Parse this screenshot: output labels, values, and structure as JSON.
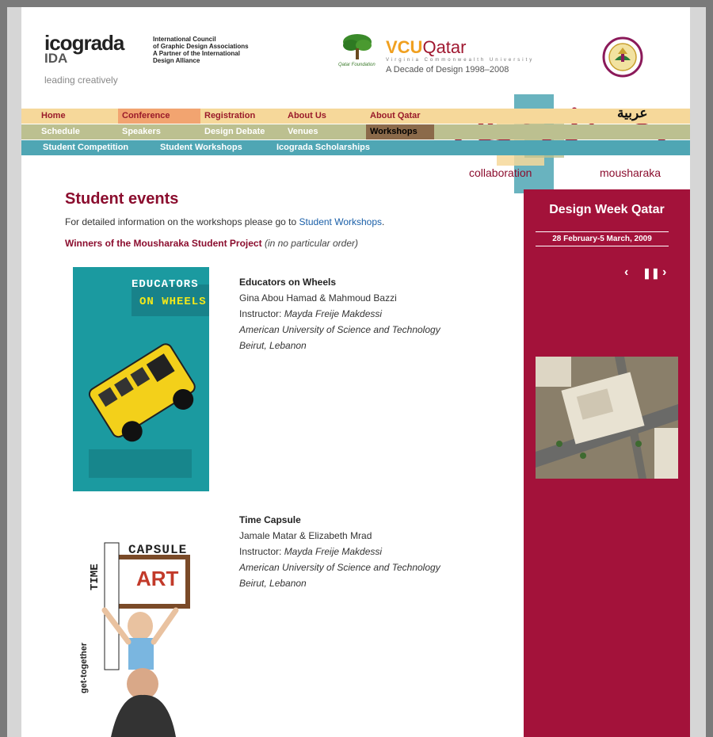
{
  "header": {
    "icograda": {
      "name": "icograda",
      "sub": "IDA",
      "tagline": "leading creatively"
    },
    "council_lines": [
      "International Council",
      "of Graphic Design Associations",
      "A Partner of the International",
      "Design Alliance"
    ],
    "qatar_foundation_label": "Qatar Foundation",
    "vcu": {
      "part1": "VCU",
      "part2": "Qatar",
      "sub": "Virginia Commonwealth University",
      "decade": "A Decade of Design 1998–2008"
    }
  },
  "nav": {
    "row1": [
      "Home",
      "Conference",
      "Registration",
      "About Us",
      "About Qatar"
    ],
    "row2": [
      "Schedule",
      "Speakers",
      "Design Debate",
      "Venues",
      "Workshops"
    ],
    "row3": [
      "Student Competition",
      "Student Workshops",
      "Icograda Scholarships"
    ],
    "arabic": "عربية",
    "active_row1": "Conference",
    "active_row2": "Workshops"
  },
  "brand_mark": {
    "arabic": "مشاركة",
    "left": "collaboration",
    "right": "mousharaka"
  },
  "main": {
    "title": "Student events",
    "intro_prefix": "For detailed information on the workshops please go to ",
    "intro_link": "Student Workshops",
    "intro_suffix": ".",
    "winners_bold": "Winners of the Mousharaka Student Project",
    "winners_italic": "(in no particular order)",
    "entries": [
      {
        "title": "Educators on Wheels",
        "students": "Gina Abou Hamad & Mahmoud Bazzi",
        "instructor_label": "Instructor: ",
        "instructor": "Mayda Freije Makdessi",
        "school": "American University of Science and Technology",
        "city": "Beirut, Lebanon",
        "poster_title_1": "EDUCATORS",
        "poster_title_2": "ON WHEELS"
      },
      {
        "title": "Time Capsule",
        "students": "Jamale Matar & Elizabeth Mrad",
        "instructor_label": "Instructor: ",
        "instructor": "Mayda Freije Makdessi",
        "school": "American University of Science and Technology",
        "city": "Beirut, Lebanon",
        "poster_title_1": "CAPSULE",
        "poster_title_2": "ART",
        "poster_side": "TIME",
        "poster_caption": "get-together"
      }
    ]
  },
  "sidebar": {
    "title": "Design Week Qatar",
    "date": "28 February-5 March, 2009"
  },
  "colors": {
    "accent": "#8b0d2e",
    "sidebar": "#a3123a",
    "nav_row1": "#f6d89a",
    "nav_row2": "#bcc090",
    "nav_row3": "#4fa6b4",
    "link": "#1a5fa8"
  }
}
